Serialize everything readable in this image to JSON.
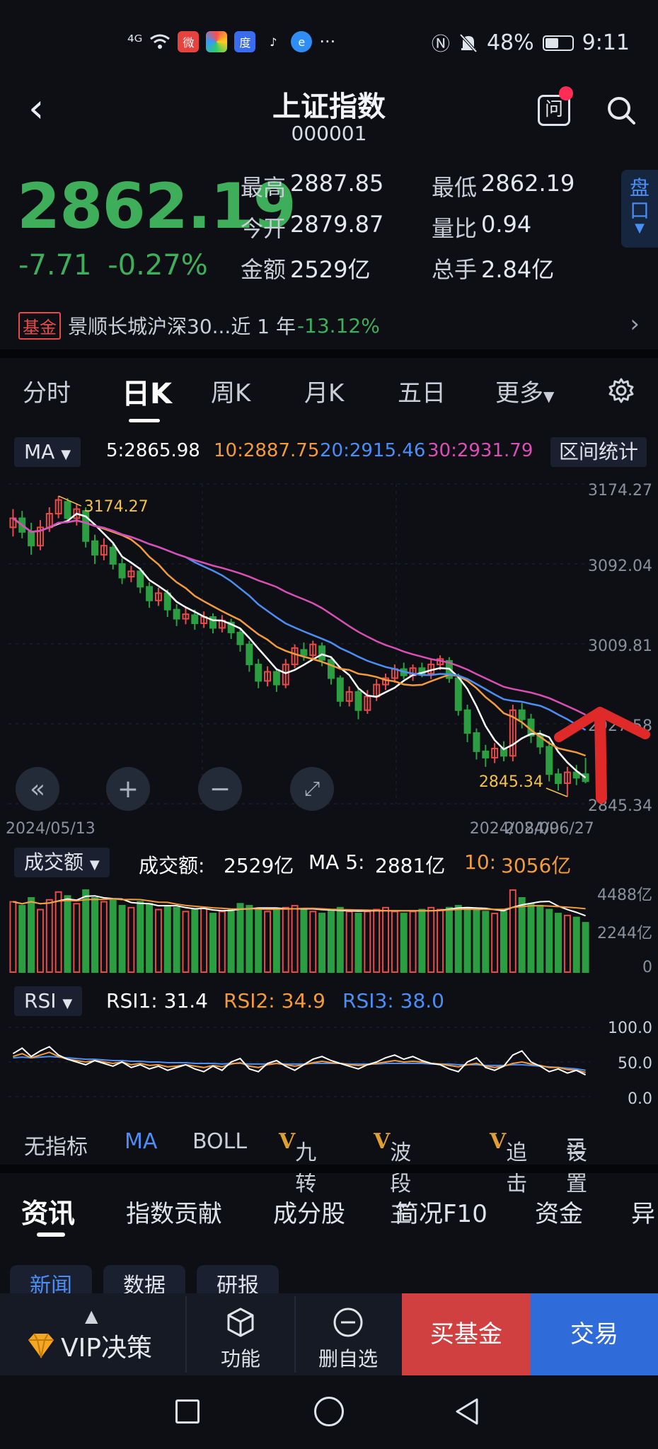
{
  "status_bar": {
    "signal": "⁴ᴳ",
    "battery": "48%",
    "time": "9:11",
    "more": "···"
  },
  "header": {
    "title": "上证指数",
    "code": "000001",
    "ask_label": "问"
  },
  "quote": {
    "price": "2862.19",
    "change": "-7.71",
    "change_pct": "-0.27%",
    "high_label": "最高",
    "high": "2887.85",
    "low_label": "最低",
    "low": "2862.19",
    "open_label": "今开",
    "open": "2879.87",
    "vol_ratio_label": "量比",
    "vol_ratio": "0.94",
    "amount_label": "金额",
    "amount": "2529亿",
    "total_label": "总手",
    "total": "2.84亿",
    "panel_tab": "盘口"
  },
  "fund": {
    "badge": "基金",
    "text": "景顺长城沪深30...近 1 年",
    "return": "-13.12%"
  },
  "chart_tabs": [
    "分时",
    "日K",
    "周K",
    "月K",
    "五日",
    "更多"
  ],
  "ma_legend": {
    "select": "MA",
    "ma5": "5:2865.98",
    "ma10": "10:2887.75",
    "ma20": "20:2915.46",
    "ma30": "30:2931.79",
    "range_stats": "区间统计"
  },
  "colors": {
    "up": "#e84a4a",
    "down": "#2c9e42",
    "ma5": "#ffffff",
    "ma10": "#f39a3d",
    "ma20": "#4b8ef5",
    "ma30": "#d94fb5",
    "annotation_arrow": "#e02a2a"
  },
  "price_axis": [
    "3174.27",
    "3092.04",
    "3009.81",
    "2927.58",
    "2845.34"
  ],
  "date_axis": [
    "2024/05/13",
    "2024/06/27",
    "2024/08/09"
  ],
  "annotations": {
    "high": "3174.27",
    "low": "2845.34"
  },
  "volume": {
    "select": "成交额",
    "label": "成交额:",
    "value": "2529亿",
    "ma5_label": "MA 5:",
    "ma5": "2881亿",
    "ma10_label": "10:",
    "ma10": "3056亿",
    "axis": [
      "4488亿",
      "2244亿",
      "0"
    ]
  },
  "rsi": {
    "select": "RSI",
    "rsi1": "RSI1: 31.4",
    "rsi2": "RSI2: 34.9",
    "rsi3": "RSI3: 38.0",
    "axis": [
      "100.0",
      "50.0",
      "0.0"
    ]
  },
  "indicators": [
    "无指标",
    "MA",
    "BOLL",
    "九转",
    "波段王",
    "追击",
    "设置"
  ],
  "info_tabs": [
    "资讯",
    "指数贡献",
    "成分股",
    "简况F10",
    "资金",
    "异"
  ],
  "sub_chips": [
    "新闻",
    "数据",
    "研报"
  ],
  "bottom": {
    "vip": "VIP决策",
    "func": "功能",
    "remove": "删自选",
    "buy_fund": "买基金",
    "trade": "交易"
  },
  "chart_data": {
    "type": "candlestick",
    "x_range": [
      "2024/05/13",
      "2024/08/09"
    ],
    "ylim": [
      2845.34,
      3174.27
    ],
    "high_marker": 3174.27,
    "low_marker": 2845.34,
    "ma": {
      "ma5": 2865.98,
      "ma10": 2887.75,
      "ma20": 2915.46,
      "ma30": 2931.79
    },
    "candles": [
      {
        "o": 3140,
        "c": 3150,
        "h": 3160,
        "l": 3130
      },
      {
        "o": 3150,
        "c": 3135,
        "h": 3158,
        "l": 3128
      },
      {
        "o": 3135,
        "c": 3120,
        "h": 3145,
        "l": 3110
      },
      {
        "o": 3120,
        "c": 3140,
        "h": 3148,
        "l": 3115
      },
      {
        "o": 3140,
        "c": 3155,
        "h": 3162,
        "l": 3135
      },
      {
        "o": 3155,
        "c": 3170,
        "h": 3174.27,
        "l": 3150
      },
      {
        "o": 3168,
        "c": 3150,
        "h": 3172,
        "l": 3145
      },
      {
        "o": 3150,
        "c": 3160,
        "h": 3166,
        "l": 3142
      },
      {
        "o": 3158,
        "c": 3125,
        "h": 3162,
        "l": 3118
      },
      {
        "o": 3125,
        "c": 3110,
        "h": 3132,
        "l": 3100
      },
      {
        "o": 3110,
        "c": 3120,
        "h": 3128,
        "l": 3104
      },
      {
        "o": 3118,
        "c": 3100,
        "h": 3124,
        "l": 3094
      },
      {
        "o": 3100,
        "c": 3085,
        "h": 3106,
        "l": 3078
      },
      {
        "o": 3086,
        "c": 3092,
        "h": 3098,
        "l": 3080
      },
      {
        "o": 3092,
        "c": 3075,
        "h": 3096,
        "l": 3068
      },
      {
        "o": 3075,
        "c": 3060,
        "h": 3080,
        "l": 3052
      },
      {
        "o": 3060,
        "c": 3068,
        "h": 3074,
        "l": 3054
      },
      {
        "o": 3068,
        "c": 3050,
        "h": 3072,
        "l": 3042
      },
      {
        "o": 3050,
        "c": 3040,
        "h": 3056,
        "l": 3032
      },
      {
        "o": 3040,
        "c": 3045,
        "h": 3052,
        "l": 3034
      },
      {
        "o": 3044,
        "c": 3035,
        "h": 3050,
        "l": 3028
      },
      {
        "o": 3035,
        "c": 3042,
        "h": 3048,
        "l": 3030
      },
      {
        "o": 3042,
        "c": 3030,
        "h": 3046,
        "l": 3024
      },
      {
        "o": 3030,
        "c": 3038,
        "h": 3044,
        "l": 3025
      },
      {
        "o": 3036,
        "c": 3025,
        "h": 3040,
        "l": 3018
      },
      {
        "o": 3025,
        "c": 3012,
        "h": 3030,
        "l": 3004
      },
      {
        "o": 3012,
        "c": 2990,
        "h": 3016,
        "l": 2982
      },
      {
        "o": 2990,
        "c": 2972,
        "h": 2996,
        "l": 2964
      },
      {
        "o": 2972,
        "c": 2982,
        "h": 2988,
        "l": 2966
      },
      {
        "o": 2982,
        "c": 2968,
        "h": 2986,
        "l": 2960
      },
      {
        "o": 2968,
        "c": 2990,
        "h": 2996,
        "l": 2964
      },
      {
        "o": 2990,
        "c": 3008,
        "h": 3012,
        "l": 2986
      },
      {
        "o": 3006,
        "c": 3000,
        "h": 3014,
        "l": 2994
      },
      {
        "o": 3000,
        "c": 3012,
        "h": 3016,
        "l": 2996
      },
      {
        "o": 3010,
        "c": 2995,
        "h": 3014,
        "l": 2988
      },
      {
        "o": 2995,
        "c": 2975,
        "h": 2999,
        "l": 2968
      },
      {
        "o": 2975,
        "c": 2950,
        "h": 2978,
        "l": 2944
      },
      {
        "o": 2950,
        "c": 2960,
        "h": 2966,
        "l": 2944
      },
      {
        "o": 2960,
        "c": 2940,
        "h": 2964,
        "l": 2930
      },
      {
        "o": 2940,
        "c": 2955,
        "h": 2962,
        "l": 2936
      },
      {
        "o": 2955,
        "c": 2968,
        "h": 2974,
        "l": 2950
      },
      {
        "o": 2968,
        "c": 2975,
        "h": 2980,
        "l": 2962
      },
      {
        "o": 2975,
        "c": 2985,
        "h": 2990,
        "l": 2970
      },
      {
        "o": 2985,
        "c": 2978,
        "h": 2992,
        "l": 2974
      },
      {
        "o": 2978,
        "c": 2986,
        "h": 2990,
        "l": 2972
      },
      {
        "o": 2986,
        "c": 2980,
        "h": 2992,
        "l": 2976
      },
      {
        "o": 2980,
        "c": 2990,
        "h": 2995,
        "l": 2974
      },
      {
        "o": 2990,
        "c": 2996,
        "h": 3000,
        "l": 2984
      },
      {
        "o": 2994,
        "c": 2975,
        "h": 2998,
        "l": 2970
      },
      {
        "o": 2975,
        "c": 2940,
        "h": 2980,
        "l": 2934
      },
      {
        "o": 2940,
        "c": 2915,
        "h": 2946,
        "l": 2905
      },
      {
        "o": 2915,
        "c": 2895,
        "h": 2920,
        "l": 2886
      },
      {
        "o": 2895,
        "c": 2888,
        "h": 2902,
        "l": 2878
      },
      {
        "o": 2888,
        "c": 2898,
        "h": 2904,
        "l": 2882
      },
      {
        "o": 2898,
        "c": 2890,
        "h": 2906,
        "l": 2884
      },
      {
        "o": 2890,
        "c": 2940,
        "h": 2946,
        "l": 2884
      },
      {
        "o": 2940,
        "c": 2930,
        "h": 2948,
        "l": 2920
      },
      {
        "o": 2930,
        "c": 2912,
        "h": 2936,
        "l": 2904
      },
      {
        "o": 2912,
        "c": 2900,
        "h": 2918,
        "l": 2892
      },
      {
        "o": 2900,
        "c": 2870,
        "h": 2906,
        "l": 2862
      },
      {
        "o": 2870,
        "c": 2860,
        "h": 2876,
        "l": 2852
      },
      {
        "o": 2860,
        "c": 2872,
        "h": 2878,
        "l": 2845.34
      },
      {
        "o": 2872,
        "c": 2866,
        "h": 2880,
        "l": 2858
      },
      {
        "o": 2870,
        "c": 2862.19,
        "h": 2887.85,
        "l": 2860
      }
    ],
    "volume": [
      3600,
      3400,
      3800,
      3200,
      3700,
      4100,
      3900,
      3500,
      4200,
      3800,
      3600,
      3700,
      3400,
      3300,
      3600,
      3500,
      3200,
      3400,
      3300,
      3100,
      3200,
      3300,
      3000,
      3100,
      3200,
      3500,
      3400,
      3200,
      3100,
      3200,
      3300,
      3400,
      3200,
      3100,
      3000,
      3200,
      3300,
      3100,
      3000,
      3100,
      3200,
      3300,
      3100,
      3000,
      3100,
      3200,
      3300,
      3200,
      3300,
      3400,
      3300,
      3200,
      3100,
      3000,
      3100,
      4200,
      3800,
      3500,
      3400,
      3200,
      3000,
      2900,
      2800,
      2529
    ],
    "rsi1": [
      62,
      70,
      58,
      66,
      72,
      60,
      54,
      50,
      46,
      52,
      48,
      44,
      50,
      42,
      46,
      40,
      44,
      38,
      42,
      46,
      40,
      36,
      44,
      38,
      50,
      55,
      40,
      36,
      48,
      52,
      44,
      38,
      46,
      54,
      58,
      52,
      48,
      44,
      40,
      46,
      50,
      56,
      60,
      54,
      58,
      52,
      48,
      46,
      40,
      36,
      50,
      56,
      42,
      38,
      44,
      60,
      66,
      50,
      44,
      36,
      40,
      34,
      38,
      31.4
    ],
    "rsi2": [
      58,
      62,
      56,
      60,
      64,
      58,
      54,
      52,
      50,
      52,
      50,
      48,
      50,
      46,
      48,
      45,
      46,
      43,
      44,
      46,
      44,
      42,
      45,
      43,
      47,
      49,
      44,
      42,
      46,
      48,
      46,
      44,
      46,
      49,
      51,
      49,
      48,
      46,
      45,
      46,
      48,
      50,
      52,
      50,
      51,
      50,
      48,
      47,
      45,
      43,
      46,
      48,
      44,
      42,
      44,
      48,
      50,
      47,
      45,
      42,
      42,
      39,
      38,
      34.9
    ],
    "rsi3": [
      56,
      57,
      56,
      57,
      58,
      57,
      56,
      55,
      54,
      54,
      53,
      52,
      52,
      51,
      51,
      50,
      50,
      49,
      49,
      49,
      48,
      48,
      48,
      47,
      48,
      48,
      47,
      47,
      47,
      48,
      47,
      47,
      47,
      48,
      48,
      48,
      48,
      47,
      47,
      47,
      47,
      48,
      48,
      48,
      48,
      48,
      47,
      47,
      47,
      46,
      46,
      46,
      45,
      45,
      45,
      46,
      46,
      45,
      44,
      43,
      42,
      41,
      40,
      38.0
    ],
    "volume_ylim": [
      0,
      4488
    ],
    "rsi_ylim": [
      0,
      100
    ]
  }
}
